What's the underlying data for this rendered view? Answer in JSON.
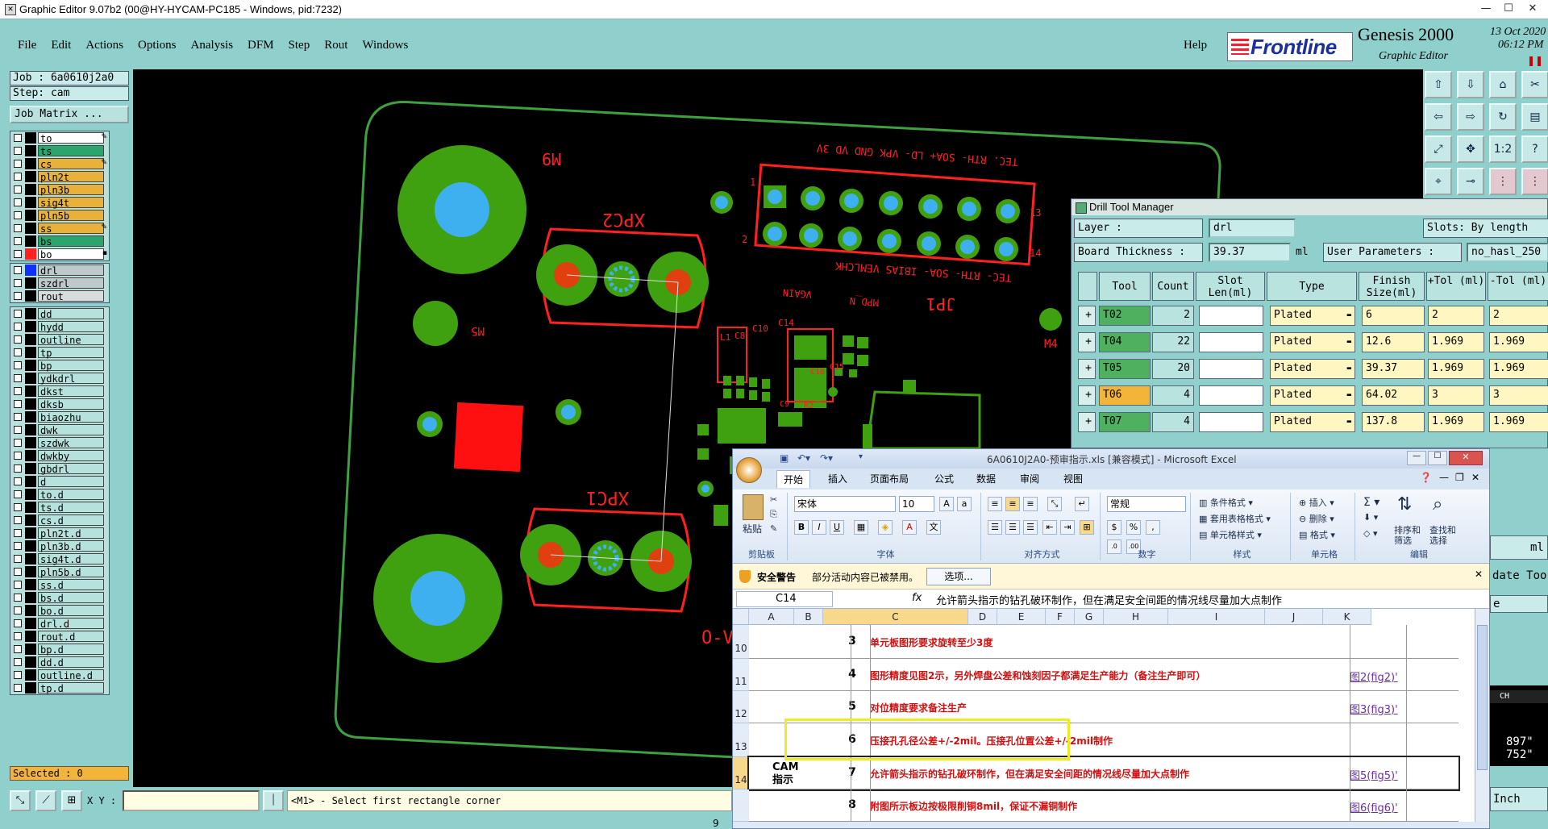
{
  "window": {
    "title": "Graphic Editor 9.07b2 (00@HY-HYCAM-PC185 - Windows, pid:7232)"
  },
  "menu": {
    "items": [
      "File",
      "Edit",
      "Actions",
      "Options",
      "Analysis",
      "DFM",
      "Step",
      "Rout",
      "Windows"
    ],
    "help": "Help"
  },
  "brand": {
    "logo": "Frontline",
    "product": "Genesis 2000",
    "subtitle": "Graphic Editor",
    "date": "13 Oct 2020",
    "time": "06:12 PM",
    "pause": "❚❚"
  },
  "left": {
    "job": "Job : 6a0610j2a0",
    "step": "Step: cam",
    "job_matrix": "Job Matrix ...",
    "selected": "Selected : 0"
  },
  "layers_top": [
    {
      "name": "to",
      "color": "#ffffff",
      "swatch": "#000000",
      "mark": "✎"
    },
    {
      "name": "ts",
      "color": "#2aa56e",
      "swatch": "#000000",
      "mark": ""
    },
    {
      "name": "cs",
      "color": "#e8b23a",
      "swatch": "#000000",
      "mark": "✎"
    },
    {
      "name": "pln2t",
      "color": "#e8b23a",
      "swatch": "#000000",
      "mark": ""
    },
    {
      "name": "pln3b",
      "color": "#e8b23a",
      "swatch": "#000000",
      "mark": ""
    },
    {
      "name": "sig4t",
      "color": "#e8b23a",
      "swatch": "#000000",
      "mark": ""
    },
    {
      "name": "pln5b",
      "color": "#e8b23a",
      "swatch": "#000000",
      "mark": ""
    },
    {
      "name": "ss",
      "color": "#e8b23a",
      "swatch": "#000000",
      "mark": "✎"
    },
    {
      "name": "bs",
      "color": "#2aa56e",
      "swatch": "#000000",
      "mark": ""
    },
    {
      "name": "bo",
      "color": "#ffffff",
      "swatch": "#ff2020",
      "mark": "▪"
    }
  ],
  "layers_drill": [
    {
      "name": "drl",
      "color": "#bfc9cc",
      "swatch": "#1030ff",
      "mark": ""
    },
    {
      "name": "szdrl",
      "color": "#bfc9cc",
      "swatch": "#000000",
      "mark": ""
    },
    {
      "name": "rout",
      "color": "#d8dcdc",
      "swatch": "#000000",
      "mark": ""
    }
  ],
  "layers_misc": [
    "dd",
    "hydd",
    "outline",
    "tp",
    "bp",
    "ydkdrl",
    "dkst",
    "dksb",
    "biaozhu",
    "dwk",
    "szdwk",
    "dwkby",
    "gbdrl",
    "d",
    "to.d",
    "ts.d",
    "cs.d",
    "pln2t.d",
    "pln3b.d",
    "sig4t.d",
    "pln5b.d",
    "ss.d",
    "bs.d",
    "bo.d",
    "drl.d",
    "rout.d",
    "bp.d",
    "dd.d",
    "outline.d",
    "tp.d"
  ],
  "canvas": {
    "labels": {
      "m9": "M9",
      "xpc2": "XPC2",
      "xpc1": "XPC1",
      "jp1": "JP1",
      "m5": "M5",
      "m4": "M4",
      "ov": "O-V",
      "pin1": "1",
      "pin2": "2",
      "pin13": "13",
      "pin14": "14",
      "top_pins": "TEC. RTH- SOA+ LD- VPK GND VD 3V",
      "bot_pins": "TEC- RTH- SOA- IBIAS VEMLCHK",
      "mpdn": "MPD_N",
      "vgain": "VGAIN",
      "c14": "C14",
      "c10": "C10",
      "c8": "C8",
      "l1": "L1",
      "c15": "C15",
      "c16": "C16",
      "c9": "C9",
      "r2": "R2"
    }
  },
  "drill_manager": {
    "title": "Drill Tool Manager",
    "layer_label": "Layer          :",
    "layer_value": "drl",
    "slots_label": "Slots: By length",
    "board_label": "Board Thickness :",
    "board_value": "39.37",
    "board_unit": "ml",
    "params_label": "User Parameters :",
    "params_value": "no_hasl_250",
    "headers": [
      "Tool",
      "Count",
      "Slot Len(ml)",
      "Type",
      "Finish Size(ml)",
      "+Tol (ml)",
      "-Tol (ml)"
    ],
    "rows": [
      {
        "tool": "T02",
        "count": "2",
        "type": "Plated",
        "finish": "6",
        "ptol": "2",
        "mtol": "2"
      },
      {
        "tool": "T04",
        "count": "22",
        "type": "Plated",
        "finish": "12.6",
        "ptol": "1.969",
        "mtol": "1.969"
      },
      {
        "tool": "T05",
        "count": "20",
        "type": "Plated",
        "finish": "39.37",
        "ptol": "1.969",
        "mtol": "1.969"
      },
      {
        "tool": "T06",
        "count": "4",
        "type": "Plated",
        "finish": "64.02",
        "ptol": "3",
        "mtol": "3"
      },
      {
        "tool": "T07",
        "count": "4",
        "type": "Plated",
        "finish": "137.8",
        "ptol": "1.969",
        "mtol": "1.969"
      }
    ]
  },
  "excel": {
    "title": "6A0610J2A0-预审指示.xls [兼容模式] - Microsoft Excel",
    "tabs": [
      "开始",
      "插入",
      "页面布局",
      "公式",
      "数据",
      "审阅",
      "视图"
    ],
    "ribbon": {
      "paste": "粘贴",
      "clipboard": "剪贴板",
      "font_name": "宋体",
      "font_size": "10",
      "font": "字体",
      "align": "对齐方式",
      "number_format": "常规",
      "number": "数字",
      "cond_format": "条件格式",
      "table_format": "套用表格格式",
      "cell_style": "单元格样式",
      "styles": "样式",
      "insert": "插入",
      "delete": "删除",
      "format": "格式",
      "cells": "单元格",
      "sort": "排序和筛选",
      "find": "查找和选择",
      "edit": "编辑"
    },
    "warning": {
      "title": "安全警告",
      "text": "部分活动内容已被禁用。",
      "button": "选项..."
    },
    "formula": {
      "cell": "C14",
      "fx": "fx",
      "content": "允许箭头指示的钻孔破环制作，但在满足安全间距的情况线尽量加大点制作"
    },
    "columns": [
      "A",
      "B",
      "C",
      "D",
      "E",
      "F",
      "G",
      "H",
      "I",
      "J",
      "K"
    ],
    "rows": [
      {
        "rn": "10",
        "n": "3",
        "text": "单元板图形要求旋转至少3度",
        "link": ""
      },
      {
        "rn": "11",
        "n": "4",
        "text": "图形精度见图2示，另外焊盘公差和蚀刻因子都满足生产能力（备注生产即可）",
        "link": "图2(fig2)'"
      },
      {
        "rn": "12",
        "n": "5",
        "text": "对位精度要求备注生产",
        "link": "图3(fig3)'"
      },
      {
        "rn": "13",
        "n": "6",
        "text": "压接孔孔径公差+/-2mil。压接孔位置公差+/-2mil制作",
        "link": ""
      },
      {
        "rn": "14",
        "n": "7",
        "text": "允许箭头指示的钻孔破环制作，但在满足安全间距的情况线尽量加大点制作",
        "link": "图5(fig5)'"
      },
      {
        "rn": "",
        "n": "8",
        "text": "附图所示板边按极限削铜8mil，保证不漏铜制作",
        "link": "图6(fig6)'"
      }
    ],
    "side_label": "CAM 指示"
  },
  "bottom": {
    "xy_label": "X Y :",
    "prompt": "<M1> - Select first rectangle corner",
    "page": "9"
  },
  "right_strips": {
    "update": "date Too",
    "e": "e",
    "ml": "ml",
    "coord1": "897\"",
    "coord2": "752\"",
    "inch": "Inch",
    "ime": "CH"
  }
}
